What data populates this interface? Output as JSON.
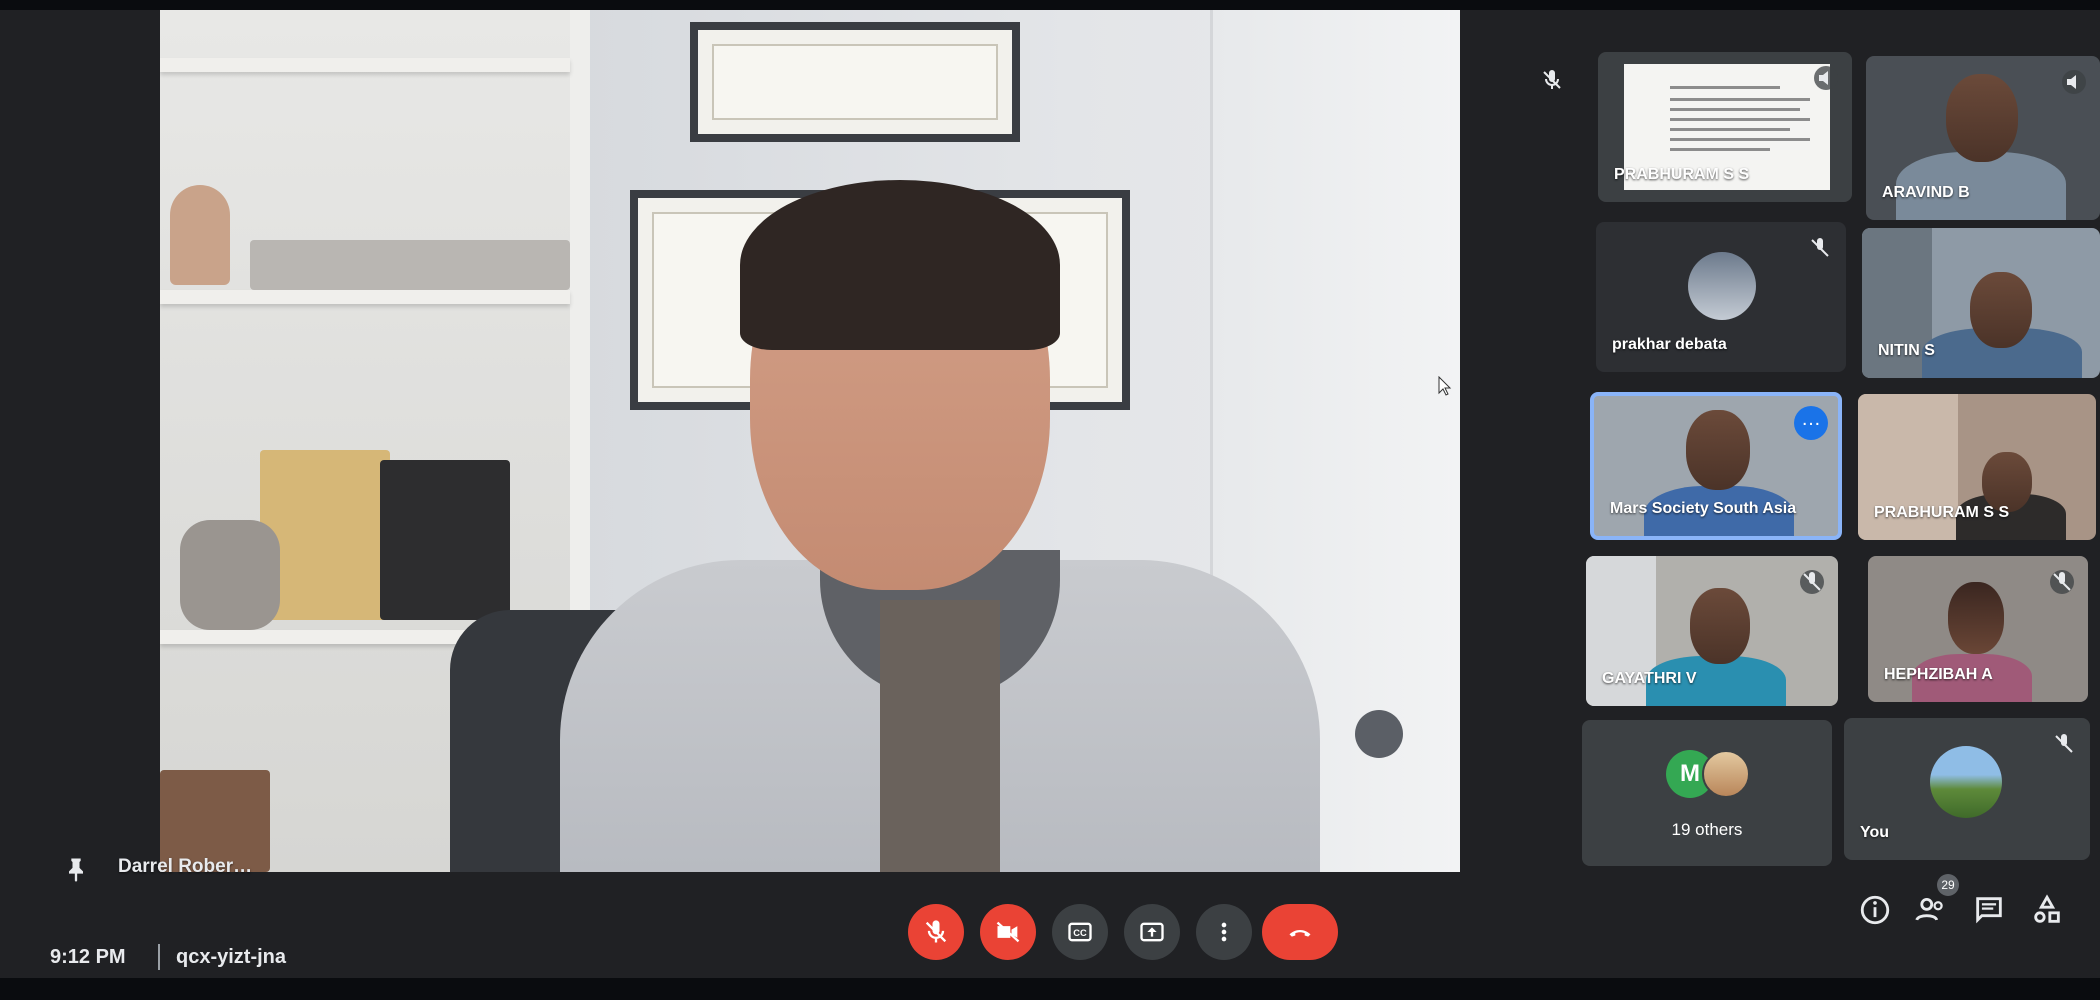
{
  "meeting": {
    "time": "9:12 PM",
    "code": "qcx-yizt-jna"
  },
  "presenter": {
    "name": "Darrel Rober…"
  },
  "participants": [
    {
      "name": "PRABHURAM S S",
      "muted": false,
      "presenting_doc": true
    },
    {
      "name": "ARAVIND B",
      "muted": false
    },
    {
      "name": "prakhar debata",
      "muted": true
    },
    {
      "name": "NITIN S",
      "muted": false
    },
    {
      "name": "Mars Society South Asia",
      "muted": false,
      "active": true
    },
    {
      "name": "PRABHURAM S S",
      "muted": false
    },
    {
      "name": "GAYATHRI V",
      "muted": true
    },
    {
      "name": "HEPHZIBAH A",
      "muted": true
    },
    {
      "name": "You",
      "muted": true
    }
  ],
  "others": {
    "label": "19 others",
    "avatar_letter": "M"
  },
  "right_toolbar": {
    "people_count": "29",
    "icons": [
      "info-icon",
      "people-icon",
      "chat-icon",
      "activities-icon"
    ]
  },
  "controls": {
    "icons": [
      "mic-off-icon",
      "camera-off-icon",
      "captions-icon",
      "present-icon",
      "more-icon",
      "end-call-icon"
    ]
  },
  "colors": {
    "accent": "#8ab4f8",
    "danger": "#ea4335",
    "surface": "#202124",
    "tile": "#3c4043"
  }
}
